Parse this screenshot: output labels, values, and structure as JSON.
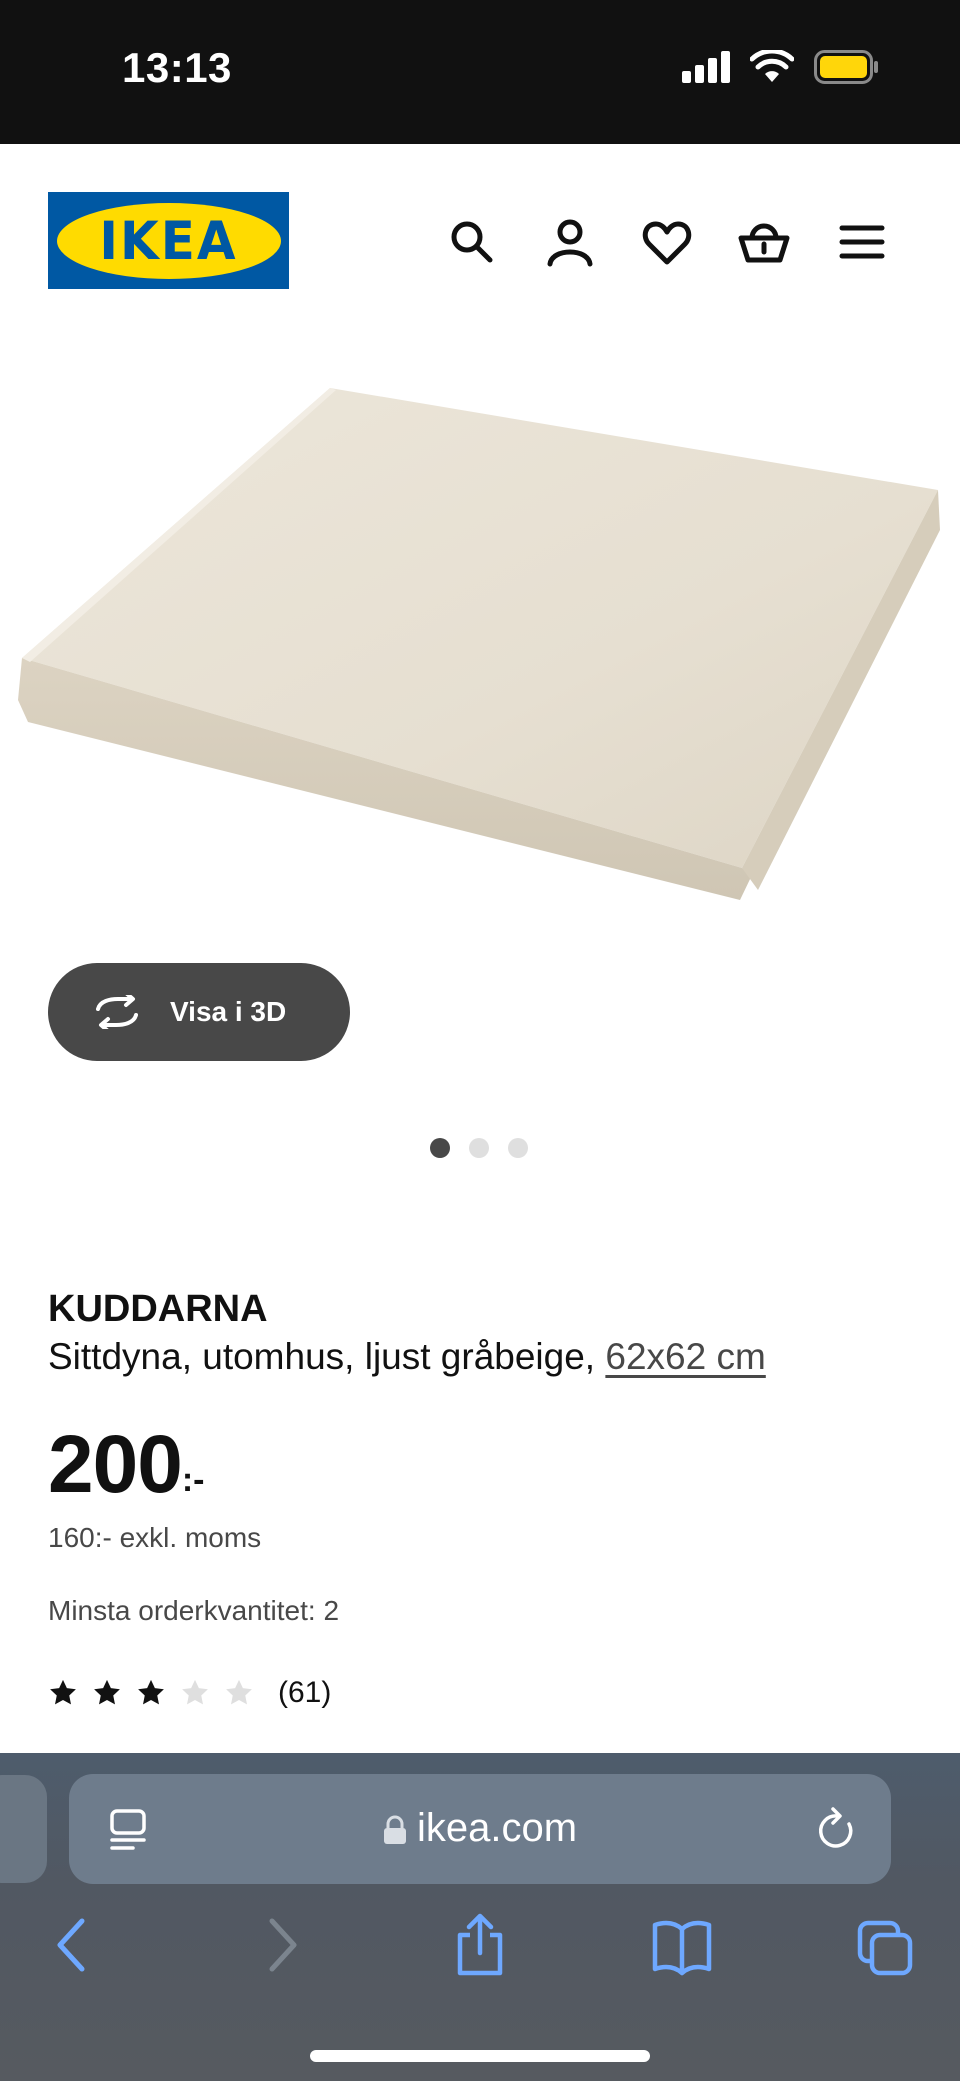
{
  "status_bar": {
    "time": "13:13",
    "battery_color": "#ffd60a"
  },
  "header": {
    "logo_text": "IKEA",
    "icons": [
      "search-icon",
      "account-icon",
      "heart-icon",
      "basket-icon",
      "menu-icon"
    ],
    "brand_colors": {
      "blue": "#0058a3",
      "yellow": "#ffdb00"
    }
  },
  "gallery": {
    "view_3d_label": "Visa i 3D",
    "image_count": 3,
    "active_index": 0
  },
  "product": {
    "name": "KUDDARNA",
    "description": "Sittdyna, utomhus, ljust gråbeige,",
    "size_link": "62x62 cm",
    "price_amount": "200",
    "price_suffix": ":-",
    "price_excl_vat": "160:- exkl. moms",
    "min_order": "Minsta orderkvantitet: 2",
    "rating": {
      "stars": 3,
      "max": 5,
      "count_label": "(61)"
    }
  },
  "browser": {
    "url": "ikea.com",
    "icons": [
      "reader-icon",
      "lock-icon",
      "reload-icon",
      "back-icon",
      "forward-icon",
      "share-icon",
      "bookmarks-icon",
      "tabs-icon"
    ]
  }
}
